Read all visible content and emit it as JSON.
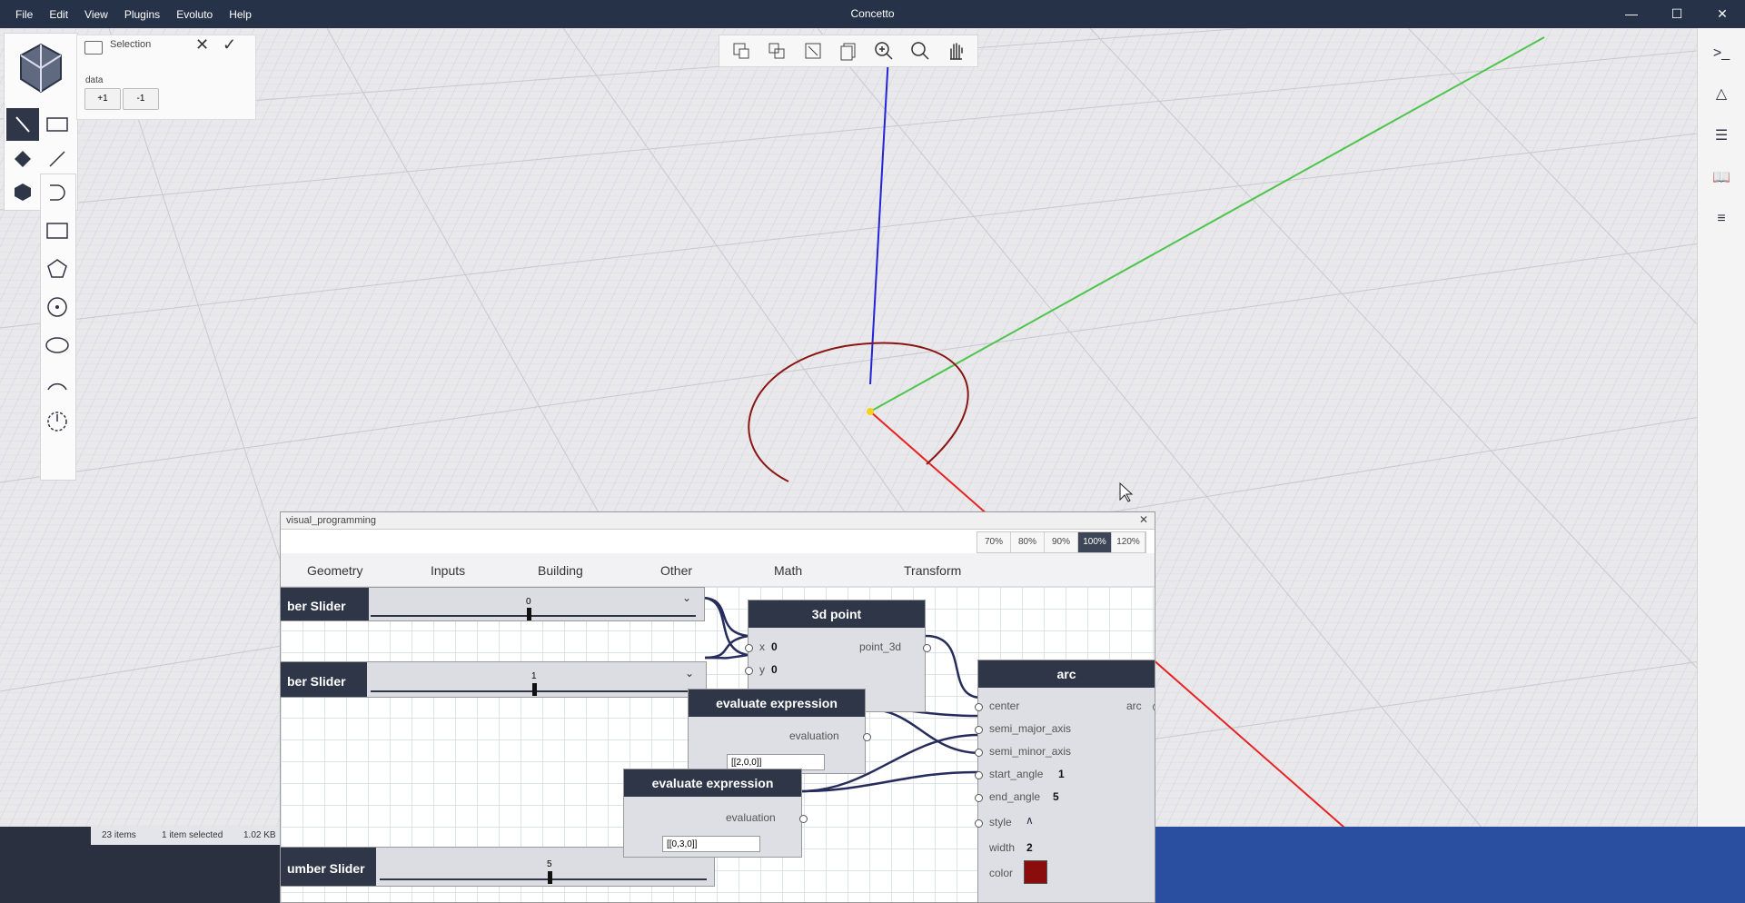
{
  "menu": {
    "items": [
      "File",
      "Edit",
      "View",
      "Plugins",
      "Evoluto",
      "Help"
    ]
  },
  "app": {
    "title": "Concetto"
  },
  "window_controls": {
    "minimize": "—",
    "maximize": "☐",
    "close": "✕"
  },
  "selection_panel": {
    "title": "Selection",
    "data_label": "data",
    "plus_label": "+1",
    "minus_label": "-1"
  },
  "visual_programming": {
    "title": "visual_programming",
    "zoom_levels": [
      "70%",
      "80%",
      "90%",
      "100%",
      "120%"
    ],
    "zoom_active": "100%",
    "categories": [
      "Geometry",
      "Inputs",
      "Building",
      "Other",
      "Math",
      "Transform"
    ],
    "sliders": [
      {
        "label": "ber Slider",
        "value": "0"
      },
      {
        "label": "ber Slider",
        "value": "1"
      },
      {
        "label": "umber Slider",
        "value": "5"
      }
    ],
    "point_node": {
      "title": "3d point",
      "in_x": "x",
      "in_x_val": "0",
      "in_y": "y",
      "in_y_val": "0",
      "out": "point_3d"
    },
    "eval_node_1": {
      "title": "evaluate expression",
      "out": "evaluation",
      "input_value": "[[2,0,0]]"
    },
    "eval_node_2": {
      "title": "evaluate expression",
      "out": "evaluation",
      "input_value": "[[0,3,0]]"
    },
    "arc_node": {
      "title": "arc",
      "out": "arc",
      "inputs": [
        {
          "name": "center",
          "value": ""
        },
        {
          "name": "semi_major_axis",
          "value": ""
        },
        {
          "name": "semi_minor_axis",
          "value": ""
        },
        {
          "name": "start_angle",
          "value": "1"
        },
        {
          "name": "end_angle",
          "value": "5"
        },
        {
          "name": "style",
          "value": "∧"
        },
        {
          "name": "width",
          "value": "2"
        },
        {
          "name": "color",
          "value": ""
        }
      ],
      "color_swatch": "#8a0c0c"
    }
  },
  "file_status": {
    "items": "23 items",
    "selected": "1 item selected",
    "size": "1.02 KB"
  }
}
